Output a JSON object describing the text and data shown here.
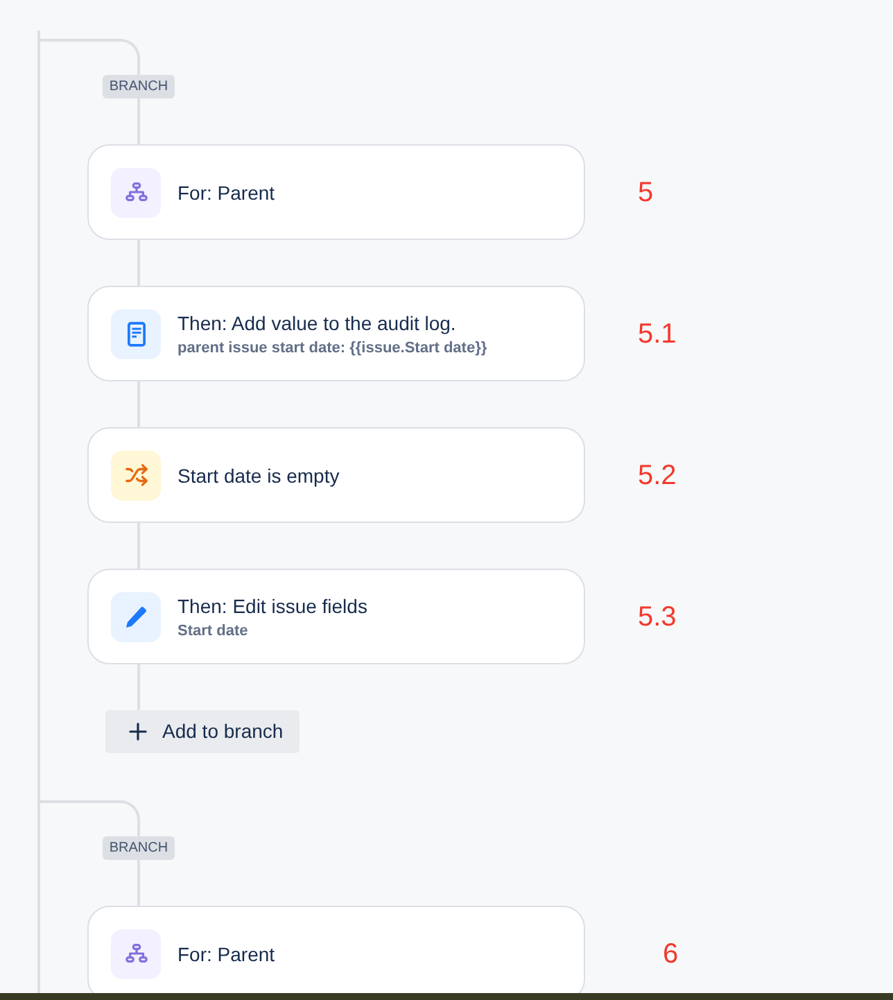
{
  "branches": [
    {
      "label": "BRANCH",
      "steps": [
        {
          "kind": "for",
          "title": "For: Parent",
          "annotation": "5"
        },
        {
          "kind": "log",
          "title": "Then: Add value to the audit log.",
          "detail": "parent issue start date: {{issue.Start date}}",
          "annotation": "5.1"
        },
        {
          "kind": "condition",
          "title": "Start date is empty",
          "annotation": "5.2"
        },
        {
          "kind": "edit",
          "title": "Then: Edit issue fields",
          "detail": "Start date",
          "annotation": "5.3"
        }
      ],
      "add_button": "Add to branch"
    },
    {
      "label": "BRANCH",
      "steps": [
        {
          "kind": "for",
          "title": "For: Parent",
          "annotation": "6"
        }
      ]
    }
  ]
}
